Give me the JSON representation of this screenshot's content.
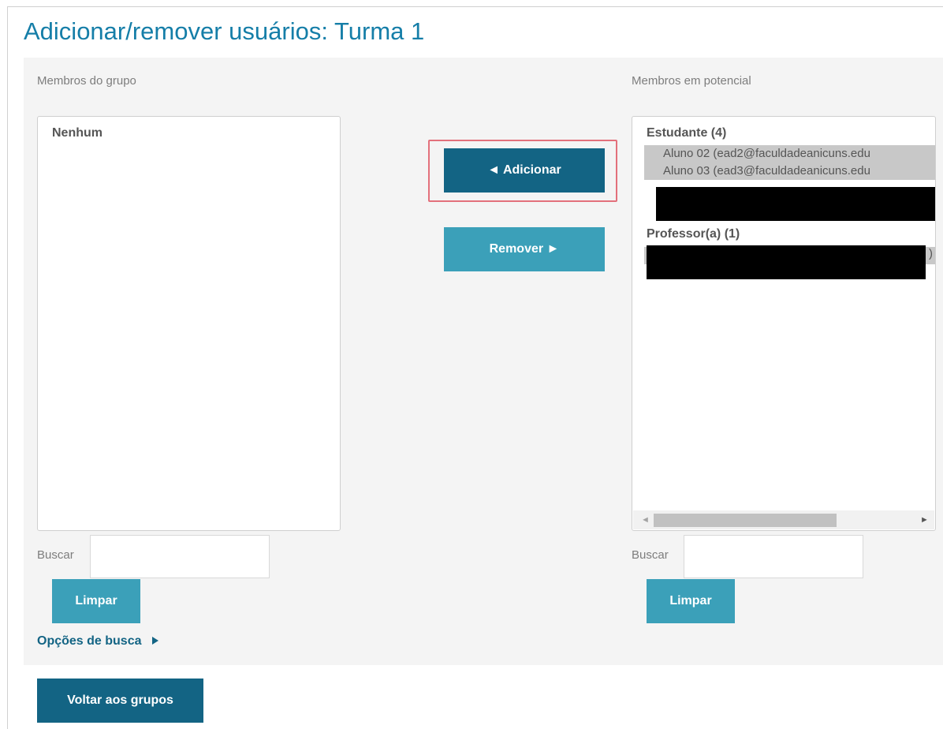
{
  "page": {
    "title": "Adicionar/remover usuários: Turma 1",
    "back_button": "Voltar aos grupos"
  },
  "left": {
    "label": "Membros do grupo",
    "empty_text": "Nenhum",
    "search_label": "Buscar",
    "search_value": "",
    "clear_button": "Limpar",
    "search_options_link": "Opções de busca",
    "search_options_icon": "caret-right-icon"
  },
  "middle": {
    "add_button": "◄ Adicionar",
    "remove_button": "Remover ►",
    "highlight_color": "#e3707b"
  },
  "right": {
    "label": "Membros em potencial",
    "groups": [
      {
        "heading": "Estudante (4)",
        "items": [
          "Aluno 02 (ead2@faculdadeanicuns.edu",
          "Aluno 03 (ead3@faculdadeanicuns.edu"
        ]
      },
      {
        "heading": "Professor(a) (1)",
        "items": []
      }
    ],
    "partial_glyph": ")",
    "search_label": "Buscar",
    "search_value": "",
    "clear_button": "Limpar"
  },
  "colors": {
    "title": "#157ea8",
    "primary_button": "#136484",
    "secondary_button": "#3ba0b9",
    "panel_bg": "#f4f4f4"
  }
}
